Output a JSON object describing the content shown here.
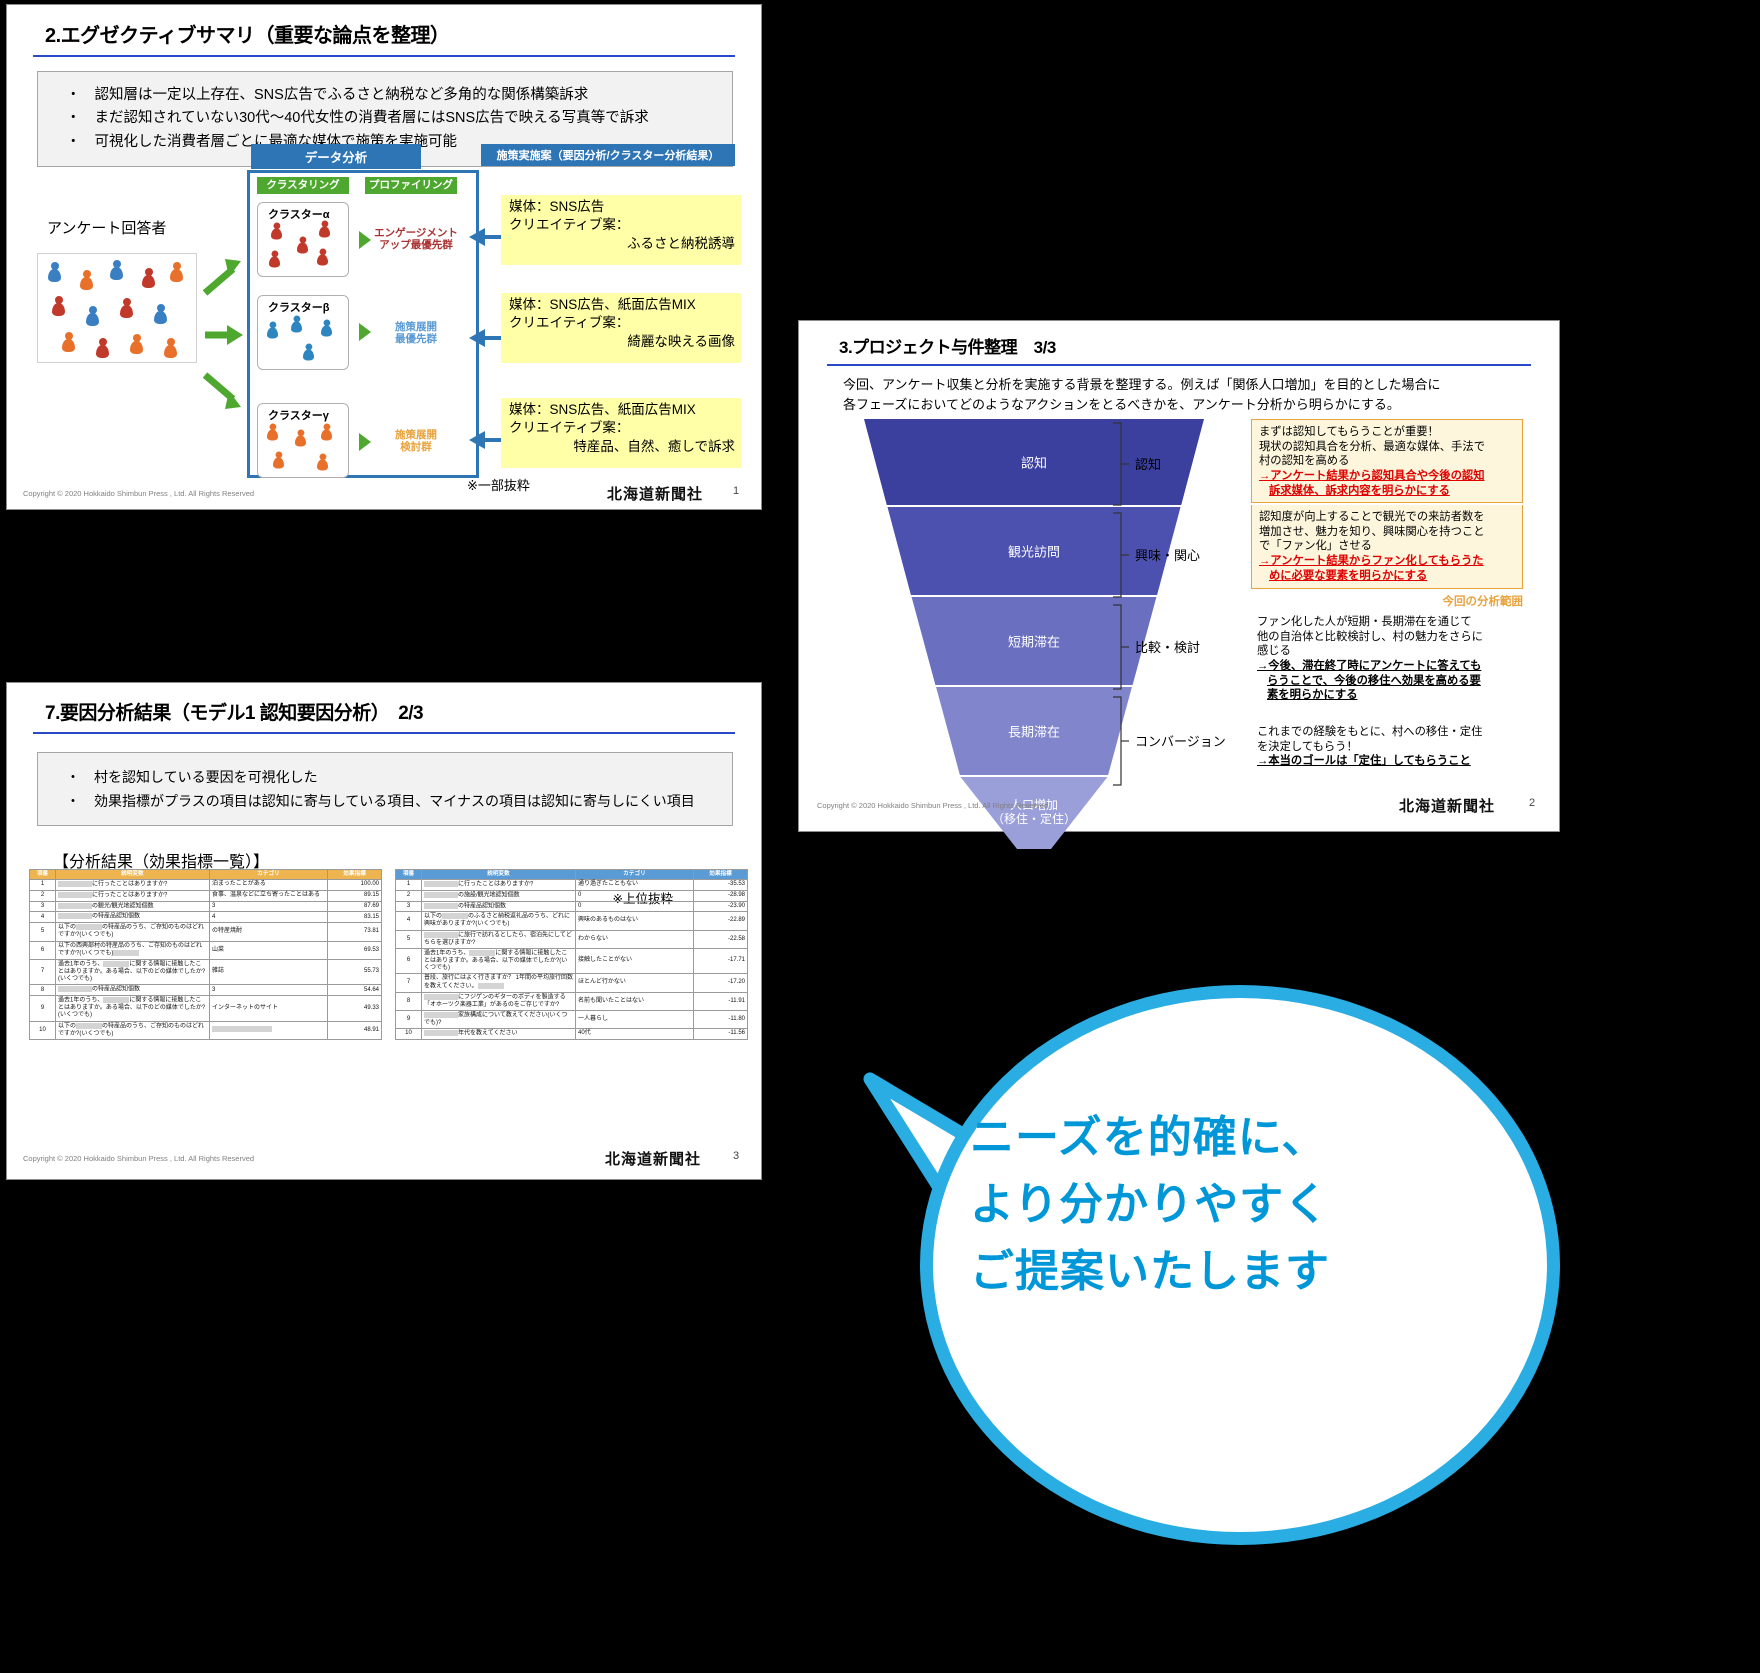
{
  "slide1": {
    "title": "2.エグゼクティブサマリ（重要な論点を整理）",
    "bullets": [
      "認知層は一定以上存在、SNS広告でふるさと納税など多角的な関係構築訴求",
      "まだ認知されていない30代〜40代女性の消費者層にはSNS広告で映える写真等で訴求",
      "可視化した消費者層ごとに最適な媒体で施策を実施可能"
    ],
    "bullet_mark": "・",
    "respondents_label": "アンケート回答者",
    "header_data_analysis": "データ分析",
    "header_measures": "施策実施案（要因分析/クラスター分析結果）",
    "col_clustering": "クラスタリング",
    "col_profiling": "プロファイリング",
    "clusters": [
      {
        "name": "クラスターα",
        "profile": "エンゲージメント\nアップ最優先群",
        "profile_color": "#a33",
        "pawn_color": "#c0392b"
      },
      {
        "name": "クラスターβ",
        "profile": "施策展開\n最優先群",
        "profile_color": "#5b9bd5",
        "pawn_color": "#2e86c1"
      },
      {
        "name": "クラスターγ",
        "profile": "施策展開\n検討群",
        "profile_color": "#e8a33d",
        "pawn_color": "#e8702a"
      }
    ],
    "proposals": [
      {
        "line1": "媒体：SNS広告",
        "line2": "クリエイティブ案：",
        "line3": "ふるさと納税誘導"
      },
      {
        "line1": "媒体：SNS広告、紙面広告MIX",
        "line2": "クリエイティブ案：",
        "line3": "綺麗な映える画像"
      },
      {
        "line1": "媒体：SNS広告、紙面広告MIX",
        "line2": "クリエイティブ案：",
        "line3": "特産品、自然、癒しで訴求"
      }
    ],
    "excerpt_note": "※一部抜粋",
    "copyright": "Copyright © 2020 Hokkaido Shimbun Press , Ltd. All Rights Reserved",
    "brand": "北海道新聞社",
    "page": "1"
  },
  "slide2": {
    "title": "3.プロジェクト与件整理　3/3",
    "lead_line1": "今回、アンケート収集と分析を実施する背景を整理する。例えば「関係人口増加」を目的とした場合に",
    "lead_line2": "各フェーズにおいてどのようなアクションをとるべきかを、アンケート分析から明らかにする。",
    "funnel": [
      {
        "label": "認知",
        "color": "#3b3f9e"
      },
      {
        "label": "観光訪問",
        "color": "#4c51b0"
      },
      {
        "label": "短期滞在",
        "color": "#6a6fc0"
      },
      {
        "label": "長期滞在",
        "color": "#8185cc"
      },
      {
        "label": "人口増加\n（移住・定住）",
        "color": "#9a9ed9"
      }
    ],
    "stages": [
      "認知",
      "興味・関心",
      "比較・検討",
      "コンバージョン"
    ],
    "notes": [
      {
        "boxed": true,
        "plain": [
          "まずは認知してもらうことが重要！",
          "現状の認知具合を分析、最適な媒体、手法で",
          "村の認知を高める"
        ],
        "emph_color": "red",
        "emph": [
          "→アンケート結果から認知具合や今後の認知",
          "訴求媒体、訴求内容を明らかにする"
        ]
      },
      {
        "boxed": true,
        "plain": [
          "認知度が向上することで観光での来訪者数を",
          "増加させ、魅力を知り、興味関心を持つこと",
          "で「ファン化」させる"
        ],
        "emph_color": "red",
        "emph": [
          "→アンケート結果からファン化してもらうた",
          "めに必要な要素を明らかにする"
        ]
      },
      {
        "boxed": false,
        "plain": [
          "ファン化した人が短期・長期滞在を通じて",
          "他の自治体と比較検討し、村の魅力をさらに",
          "感じる"
        ],
        "emph_color": "black",
        "emph": [
          "→今後、滞在終了時にアンケートに答えても",
          "らうことで、今後の移住へ効果を高める要",
          "素を明らかにする"
        ]
      },
      {
        "boxed": false,
        "plain": [
          "これまでの経験をもとに、村への移住・定住",
          "を決定してもらう！"
        ],
        "emph_color": "black",
        "emph": [
          "→本当のゴールは「定住」してもらうこと"
        ]
      }
    ],
    "scope_label": "今回の分析範囲",
    "copyright": "Copyright © 2020 Hokkaido Shimbun Press , Ltd. All Rights Reserved",
    "brand": "北海道新聞社",
    "page": "2"
  },
  "slide3": {
    "title": "7.要因分析結果（モデル1 認知要因分析）　2/3",
    "bullets": [
      "村を認知している要因を可視化した",
      "効果指標がプラスの項目は認知に寄与している項目、マイナスの項目は認知に寄与しにくい項目"
    ],
    "bullet_mark": "・",
    "section_title": "【分析結果（効果指標一覧）】",
    "excerpt_note": "※上位抜粋",
    "table_headers": [
      "項番",
      "説明変数",
      "カテゴリ",
      "効果指標"
    ],
    "table_left": [
      {
        "no": "1",
        "var_pre": "",
        "var": "に行ったことはありますか?",
        "cat": "泊まったことがある",
        "val": "100.00"
      },
      {
        "no": "2",
        "var_pre": "",
        "var": "に行ったことはありますか?",
        "cat": "食事、温泉などに立ち寄ったことはある",
        "val": "89.15"
      },
      {
        "no": "3",
        "var_pre": "",
        "var": "の観光/観光地認知個数",
        "cat": "3",
        "val": "87.69"
      },
      {
        "no": "4",
        "var_pre": "",
        "var": "の特産品認知個数",
        "cat": "4",
        "val": "83.15"
      },
      {
        "no": "5",
        "var_pre": "以下の",
        "var": "の特産品のうち、ご存知のものはどれですか?(いくつでも)",
        "cat": "の特産焼酎",
        "val": "73.81"
      },
      {
        "no": "6",
        "var_pre": "以下の西興部村の特産品のうち、ご存知のものはどれですか?(いくつでも)",
        "var": "",
        "cat": "山菜",
        "val": "69.53"
      },
      {
        "no": "7",
        "var_pre": "過去1年のうち、",
        "var": "に関する情報に接触したことはありますか。ある場合、以下のどの媒体でしたか?(いくつでも)",
        "cat": "雑誌",
        "val": "55.73"
      },
      {
        "no": "8",
        "var_pre": "",
        "var": "の特産品認知個数",
        "cat": "3",
        "val": "54.64"
      },
      {
        "no": "9",
        "var_pre": "過去1年のうち、",
        "var": "に関する情報に接触したことはありますか。ある場合、以下のどの媒体でしたか?(いくつでも)",
        "cat": "インターネットのサイト",
        "val": "49.33"
      },
      {
        "no": "10",
        "var_pre": "以下の",
        "var": "の特産品のうち、ご存知のものはどれですか?(いくつでも)",
        "cat": "",
        "val": "48.91"
      }
    ],
    "table_right": [
      {
        "no": "1",
        "var_pre": "",
        "var": "に行ったことはありますか?",
        "cat": "通り過ぎたこともない",
        "val": "-35.53"
      },
      {
        "no": "2",
        "var_pre": "",
        "var": "の施設/観光地認知個数",
        "cat": "0",
        "val": "-28.98"
      },
      {
        "no": "3",
        "var_pre": "",
        "var": "の特産品認知個数",
        "cat": "0",
        "val": "-23.90"
      },
      {
        "no": "4",
        "var_pre": "以下の",
        "var": "のふるさと納税返礼品のうち、どれに興味がありますか?(いくつでも)",
        "cat": "興味のあるものはない",
        "val": "-22.89"
      },
      {
        "no": "5",
        "var_pre": "",
        "var": "に旅行で訪れるとしたら、宿泊先にしてどちらを選びますか?",
        "cat": "わからない",
        "val": "-22.58"
      },
      {
        "no": "6",
        "var_pre": "過去1年のうち、",
        "var": "に関する情報に接触したことはありますか。ある場合、以下の媒体でしたか?(いくつでも)",
        "cat": "接触したことがない",
        "val": "-17.71"
      },
      {
        "no": "7",
        "var_pre": "普段、旅行にはよく行きますか？ 1年間の平均旅行回数を教えてください。",
        "var": "",
        "cat": "ほとんど行かない",
        "val": "-17.20"
      },
      {
        "no": "8",
        "var_pre": "",
        "var": "にフジゲンのギターのボディを製造する「オホーツク楽器工業」があるのをご存じですか?",
        "cat": "名前も聞いたことはない",
        "val": "-11.91"
      },
      {
        "no": "9",
        "var_pre": "",
        "var": "家族構成について教えてください(いくつでも)?",
        "cat": "一人暮らし",
        "val": "-11.80"
      },
      {
        "no": "10",
        "var_pre": "",
        "var": "年代を教えてください",
        "cat": "40代",
        "val": "-11.56"
      }
    ],
    "copyright": "Copyright © 2020 Hokkaido Shimbun Press , Ltd. All Rights Reserved",
    "brand": "北海道新聞社",
    "page": "3"
  },
  "bubble": {
    "lines": [
      "ニーズを的確に、",
      "より分かりやすく",
      "ご提案いたします"
    ],
    "color": "#0097d8",
    "border_color": "#29ade3"
  }
}
